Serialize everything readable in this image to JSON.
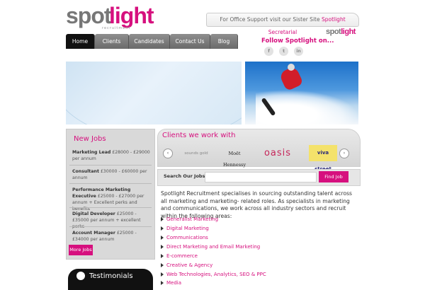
{
  "header": {
    "logo_main_grey": "spot",
    "logo_main_pink": "light",
    "logo_tagline": "recruitment",
    "office_prefix": "For Office Support visit our Sister Site ",
    "office_link": "Spotlight Secretarial",
    "sister_logo_grey": "spot",
    "sister_logo_pink": "light"
  },
  "nav": [
    "Home",
    "Clients",
    "Candidates",
    "Contact Us",
    "Blog"
  ],
  "follow": {
    "title": "Follow Spotlight on...",
    "icons": [
      "facebook-icon",
      "twitter-icon",
      "linkedin-icon"
    ],
    "glyphs": [
      "f",
      "t",
      "in"
    ]
  },
  "new_jobs": {
    "title": "New Jobs",
    "items": [
      {
        "title": "Marketing Lead",
        "detail": "£28000 - £29000 per annum"
      },
      {
        "title": "Consultant",
        "detail": "£30000 - £60000 per annum"
      },
      {
        "title": "Performance Marketing Executive",
        "detail": "£25000 - £27000 per annum + Excellent perks and benefits"
      },
      {
        "title": "Digital Developer",
        "detail": "£25000 - £35000 per annum + excellent perks"
      },
      {
        "title": "Account Manager",
        "detail": "£25000 - £34000 per annum"
      }
    ],
    "more_label": "More Jobs"
  },
  "testimonials": {
    "label": "Testimonials"
  },
  "clients": {
    "title": "Clients we work with",
    "logos": [
      "sounds gold",
      "Moët Hennessy",
      "oasis",
      "viva street"
    ],
    "prev": "‹",
    "next": "›"
  },
  "search": {
    "label": "Search Our Jobs :",
    "button": "Find Job",
    "value": ""
  },
  "intro": "Spotlight Recruitment specialises in sourcing outstanding talent across all marketing and marketing- related roles. As specialists in marketing and communications, we work across all industry sectors and recruit within the following areas:",
  "sectors": [
    "Generalist Marketing",
    "Digital Marketing",
    "Communications",
    "Direct Marketing and Email Marketing",
    "E-commerce",
    "Creative & Agency",
    "Web Technologies, Analytics, SEO & PPC",
    "Media"
  ],
  "colors": {
    "accent": "#d6107e",
    "nav": "#6b6b6b",
    "nav_active": "#111111"
  }
}
